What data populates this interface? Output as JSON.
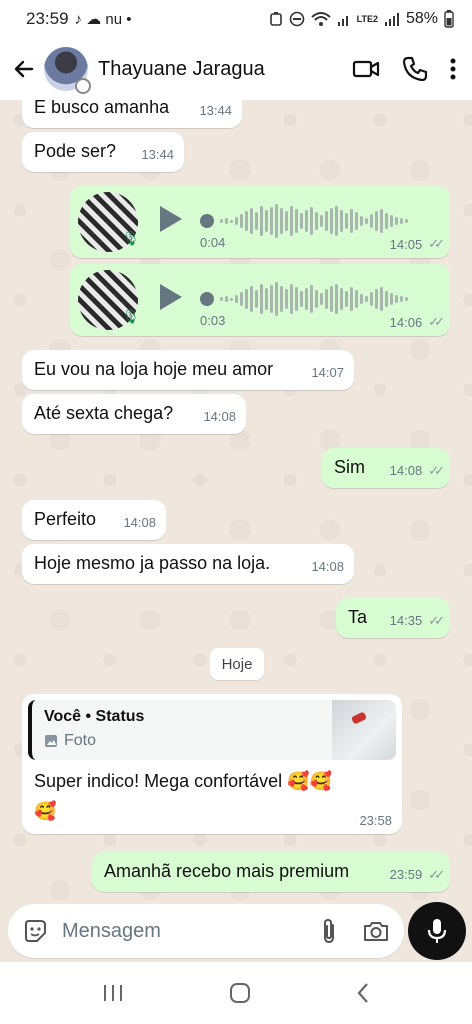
{
  "status_bar": {
    "time": "23:59",
    "notif_icons": "♪ ☁ nu •",
    "battery": "58%",
    "network": "LTE2"
  },
  "header": {
    "contact_name": "Thayuane Jaragua"
  },
  "messages": [
    {
      "text": "E busco amanha",
      "time": "13:44"
    },
    {
      "text": "Pode ser?",
      "time": "13:44"
    },
    {
      "duration": "0:04",
      "time": "14:05"
    },
    {
      "duration": "0:03",
      "time": "14:06"
    },
    {
      "text": "Eu vou na loja hoje meu amor",
      "time": "14:07"
    },
    {
      "text": "Até sexta chega?",
      "time": "14:08"
    },
    {
      "text": "Sim",
      "time": "14:08"
    },
    {
      "text": "Perfeito",
      "time": "14:08"
    },
    {
      "text": "Hoje mesmo ja passo na loja.",
      "time": "14:08"
    },
    {
      "text": "Ta",
      "time": "14:35"
    }
  ],
  "date_separator": "Hoje",
  "reply_message": {
    "quote_author": "Você • Status",
    "quote_type": "Foto",
    "text": "Super indico! Mega confortável 🥰🥰🥰",
    "time": "23:58"
  },
  "last_message": {
    "text": "Amanhã recebo mais premium",
    "time": "23:59"
  },
  "input": {
    "placeholder": "Mensagem"
  },
  "colors": {
    "outgoing_bubble": "#d9fdd3",
    "incoming_bubble": "#ffffff",
    "chat_background": "#efe7de",
    "mic_button": "#111111"
  }
}
